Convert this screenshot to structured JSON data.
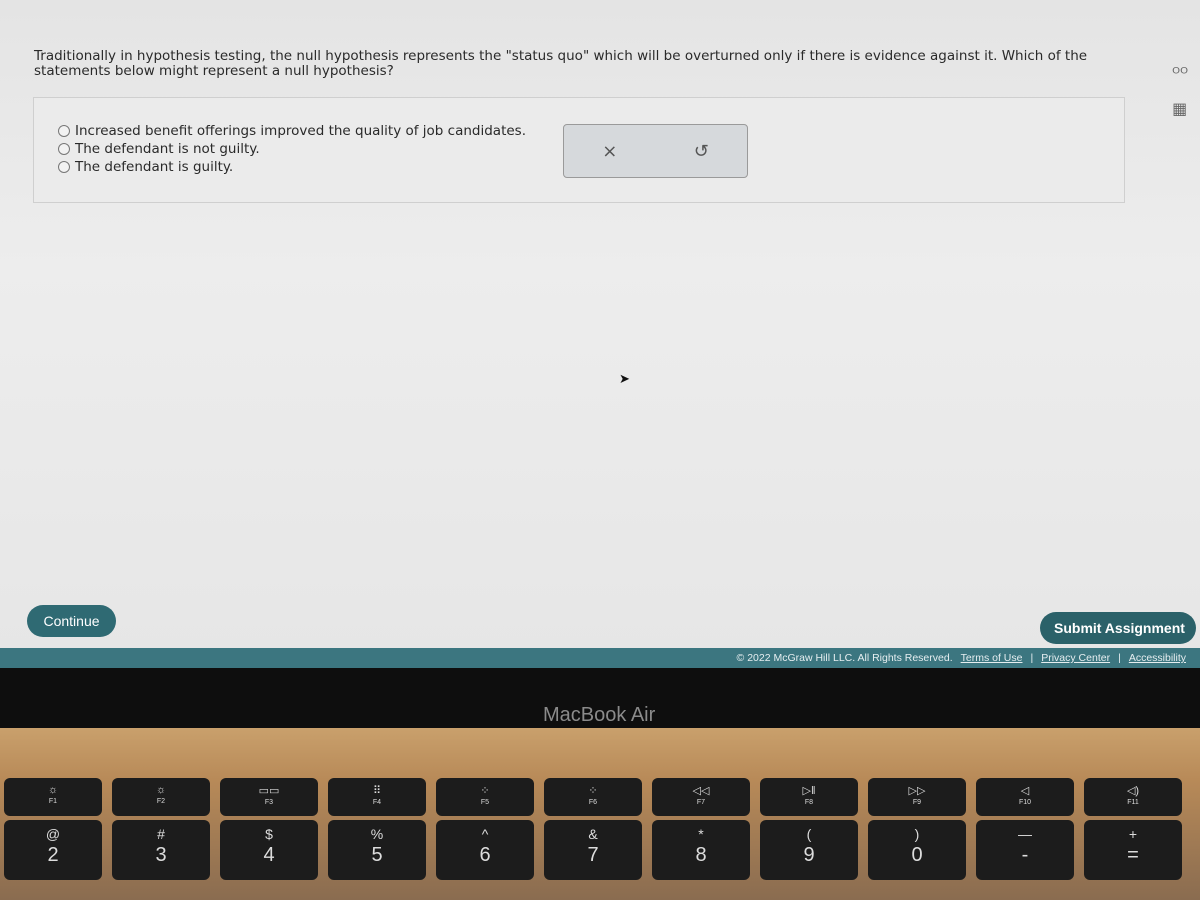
{
  "question": {
    "text": "Traditionally in hypothesis testing, the null hypothesis represents the \"status quo\" which will be overturned only if there is evidence against it. Which of the statements below might represent a null hypothesis?"
  },
  "options": [
    {
      "label": "Increased benefit offerings improved the quality of job candidates.",
      "selected": false
    },
    {
      "label": "The defendant is not guilty.",
      "selected": false
    },
    {
      "label": "The defendant is guilty.",
      "selected": false
    }
  ],
  "tools": {
    "clear": "×",
    "undo": "↺"
  },
  "side_icons": {
    "hint": "ᴼᴼ",
    "calculator": "▦"
  },
  "buttons": {
    "continue": "Continue",
    "submit": "Submit Assignment"
  },
  "footer": {
    "copyright": "© 2022 McGraw Hill LLC. All Rights Reserved.",
    "terms": "Terms of Use",
    "sep": "|",
    "privacy": "Privacy Center",
    "accessibility": "Accessibility"
  },
  "device": {
    "brand": "MacBook Air"
  },
  "fkeys": [
    {
      "icon": "☼",
      "label": "F1"
    },
    {
      "icon": "☼",
      "label": "F2"
    },
    {
      "icon": "▭▭",
      "label": "F3"
    },
    {
      "icon": "⠿",
      "label": "F4"
    },
    {
      "icon": "⁘",
      "label": "F5"
    },
    {
      "icon": "⁘",
      "label": "F6"
    },
    {
      "icon": "◁◁",
      "label": "F7"
    },
    {
      "icon": "▷‖",
      "label": "F8"
    },
    {
      "icon": "▷▷",
      "label": "F9"
    },
    {
      "icon": "◁",
      "label": "F10"
    },
    {
      "icon": "◁)",
      "label": "F11"
    }
  ],
  "numkeys": [
    {
      "sym": "@",
      "num": "2"
    },
    {
      "sym": "#",
      "num": "3"
    },
    {
      "sym": "$",
      "num": "4"
    },
    {
      "sym": "%",
      "num": "5"
    },
    {
      "sym": "^",
      "num": "6"
    },
    {
      "sym": "&",
      "num": "7"
    },
    {
      "sym": "*",
      "num": "8"
    },
    {
      "sym": "(",
      "num": "9"
    },
    {
      "sym": ")",
      "num": "0"
    },
    {
      "sym": "—",
      "num": "-"
    },
    {
      "sym": "+",
      "num": "="
    }
  ]
}
